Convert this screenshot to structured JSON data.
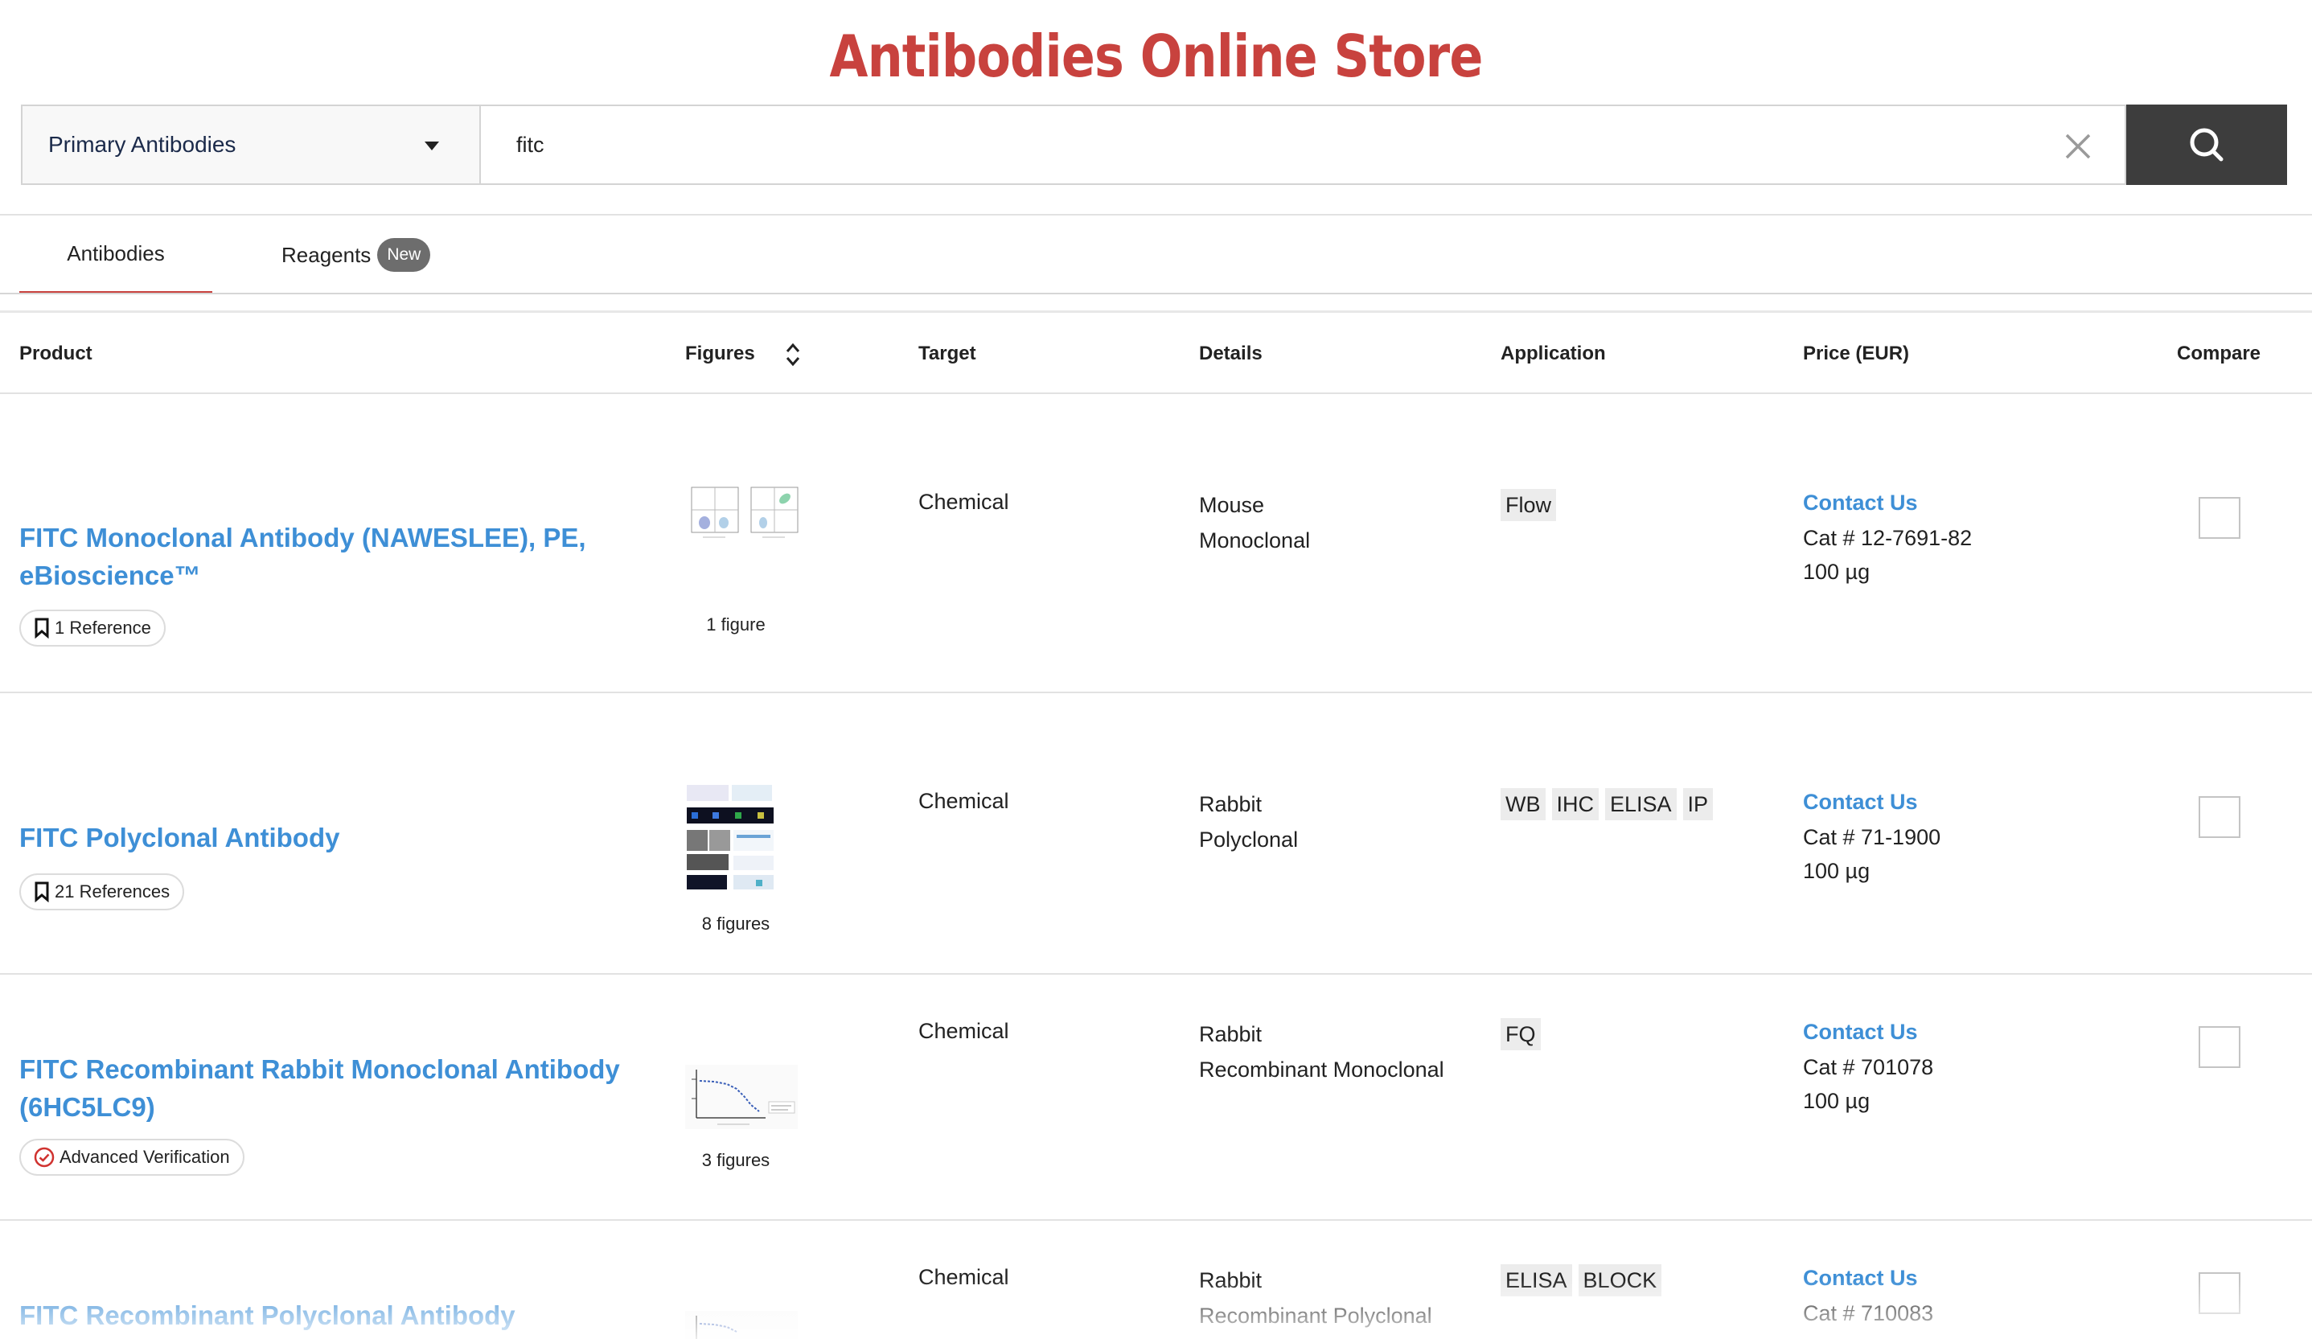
{
  "site": {
    "title": "Antibodies Online Store"
  },
  "search": {
    "category": "Primary Antibodies",
    "query": "fitc"
  },
  "tabs": [
    {
      "label": "Antibodies",
      "active": true
    },
    {
      "label": "Reagents",
      "badge": "New",
      "active": false
    }
  ],
  "table": {
    "headers": {
      "product": "Product",
      "figures": "Figures",
      "target": "Target",
      "details": "Details",
      "application": "Application",
      "price": "Price (EUR)",
      "compare": "Compare"
    },
    "rows": [
      {
        "name_line1": "FITC Monoclonal Antibody (NAWESLEE), PE,",
        "name_line2": "eBioscience™",
        "pill": "1 Reference",
        "pill_icon": "bookmark-icon",
        "figures": "1 figure",
        "target": "Chemical",
        "host": "Mouse",
        "clonality": "Monoclonal",
        "applications": [
          "Flow"
        ],
        "contact": "Contact Us",
        "cat": "Cat # 12-7691-82",
        "size": "100 µg"
      },
      {
        "name_line1": "FITC Polyclonal Antibody",
        "name_line2": "",
        "pill": "21 References",
        "pill_icon": "bookmark-icon",
        "figures": "8 figures",
        "target": "Chemical",
        "host": "Rabbit",
        "clonality": "Polyclonal",
        "applications": [
          "WB",
          "IHC",
          "ELISA",
          "IP"
        ],
        "contact": "Contact Us",
        "cat": "Cat # 71-1900",
        "size": "100 µg"
      },
      {
        "name_line1": "FITC Recombinant Rabbit Monoclonal Antibody",
        "name_line2": "(6HC5LC9)",
        "pill": "Advanced Verification",
        "pill_icon": "verified-check-icon",
        "figures": "3 figures",
        "target": "Chemical",
        "host": "Rabbit",
        "clonality": "Recombinant Monoclonal",
        "applications": [
          "FQ"
        ],
        "contact": "Contact Us",
        "cat": "Cat # 701078",
        "size": "100 µg"
      },
      {
        "name_line1": "FITC Recombinant Polyclonal Antibody",
        "name_line2": "",
        "target": "Chemical",
        "host": "Rabbit",
        "clonality": "Recombinant Polyclonal",
        "applications": [
          "ELISA",
          "BLOCK"
        ],
        "contact": "Contact Us",
        "cat": "Cat # 710083"
      }
    ]
  },
  "colors": {
    "brand_red": "#c8423e",
    "link_blue": "#3e8fd6",
    "search_button": "#3d3d3d",
    "tag_background": "#ececec"
  }
}
